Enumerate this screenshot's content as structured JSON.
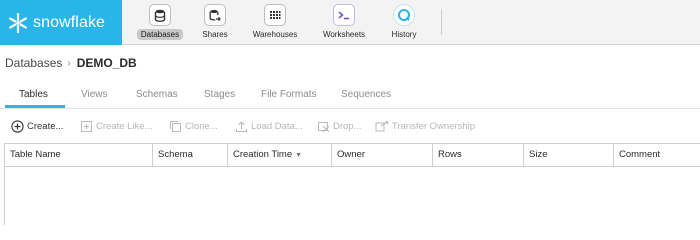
{
  "brand": {
    "name": "snowflake",
    "accent": "#29b5e8"
  },
  "nav": {
    "items": [
      {
        "label": "Databases",
        "icon": "database-icon",
        "active": true
      },
      {
        "label": "Shares",
        "icon": "share-icon",
        "active": false
      },
      {
        "label": "Warehouses",
        "icon": "warehouse-icon",
        "active": false
      },
      {
        "label": "Worksheets",
        "icon": "worksheet-icon",
        "active": false
      },
      {
        "label": "History",
        "icon": "history-icon",
        "active": false
      }
    ]
  },
  "breadcrumb": {
    "root": "Databases",
    "current": "DEMO_DB"
  },
  "tabs": [
    {
      "label": "Tables",
      "active": true
    },
    {
      "label": "Views",
      "active": false
    },
    {
      "label": "Schemas",
      "active": false
    },
    {
      "label": "Stages",
      "active": false
    },
    {
      "label": "File Formats",
      "active": false
    },
    {
      "label": "Sequences",
      "active": false
    }
  ],
  "toolbar": [
    {
      "label": "Create...",
      "icon": "plus-circle-icon",
      "enabled": true
    },
    {
      "label": "Create Like...",
      "icon": "create-like-icon",
      "enabled": false
    },
    {
      "label": "Clone...",
      "icon": "clone-icon",
      "enabled": false
    },
    {
      "label": "Load Data...",
      "icon": "upload-icon",
      "enabled": false
    },
    {
      "label": "Drop...",
      "icon": "drop-icon",
      "enabled": false
    },
    {
      "label": "Transfer Ownership",
      "icon": "transfer-icon",
      "enabled": false
    }
  ],
  "table": {
    "columns": [
      "Table Name",
      "Schema",
      "Creation Time",
      "Owner",
      "Rows",
      "Size",
      "Comment"
    ],
    "sorted_column": "Creation Time",
    "sort_indicator": "▼",
    "rows": []
  }
}
